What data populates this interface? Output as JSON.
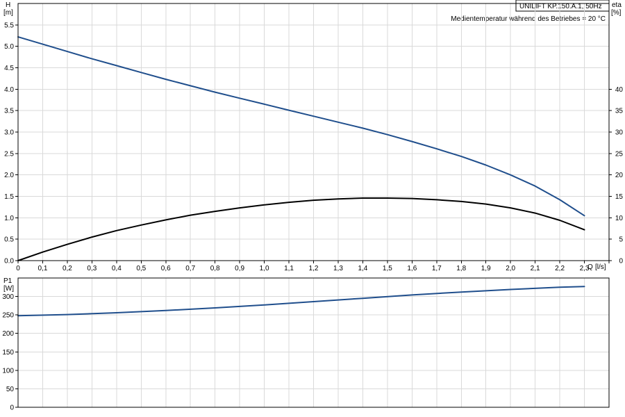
{
  "header": {
    "model": "UNILIFT KP.150.A.1, 50Hz",
    "note": "Medientemperatur während des Betriebes = 20 °C"
  },
  "colors": {
    "head": "#1f4e8c",
    "efficiency": "#000000",
    "power": "#1f4e8c"
  },
  "chart_data": [
    {
      "type": "line",
      "panel": "performance",
      "x_label": "Q",
      "x_unit": "[l/s]",
      "x_ticks": [
        "0",
        "0,1",
        "0,2",
        "0,3",
        "0,4",
        "0,5",
        "0,6",
        "0,7",
        "0,8",
        "0,9",
        "1,0",
        "1,1",
        "1,2",
        "1,3",
        "1,4",
        "1,5",
        "1,6",
        "1,7",
        "1,8",
        "1,9",
        "2,0",
        "2,1",
        "2,2",
        "2,3"
      ],
      "xlim": [
        0,
        2.4
      ],
      "y_label": "H",
      "y_unit": "[m]",
      "y_ticks": [
        "0.0",
        "0.5",
        "1.0",
        "1.5",
        "2.0",
        "2.5",
        "3.0",
        "3.5",
        "4.0",
        "4.5",
        "5.0",
        "5.5"
      ],
      "ylim": [
        0,
        6.0
      ],
      "y2_label": "eta",
      "y2_unit": "[%]",
      "y2_ticks": [
        "0",
        "5",
        "10",
        "15",
        "20",
        "25",
        "30",
        "35",
        "40"
      ],
      "y2lim": [
        0,
        60
      ],
      "grid": true,
      "series": [
        {
          "axis": "left",
          "color": "#1f4e8c",
          "x": [
            0,
            0.1,
            0.2,
            0.3,
            0.4,
            0.5,
            0.6,
            0.7,
            0.8,
            0.9,
            1.0,
            1.1,
            1.2,
            1.3,
            1.4,
            1.5,
            1.6,
            1.7,
            1.8,
            1.9,
            2.0,
            2.1,
            2.2,
            2.3
          ],
          "y": [
            5.22,
            5.05,
            4.88,
            4.71,
            4.55,
            4.39,
            4.23,
            4.08,
            3.93,
            3.79,
            3.65,
            3.51,
            3.37,
            3.23,
            3.09,
            2.94,
            2.78,
            2.61,
            2.43,
            2.23,
            2.0,
            1.74,
            1.42,
            1.05
          ]
        },
        {
          "axis": "right",
          "color": "#000000",
          "x": [
            0,
            0.1,
            0.2,
            0.3,
            0.4,
            0.5,
            0.6,
            0.7,
            0.8,
            0.9,
            1.0,
            1.1,
            1.2,
            1.3,
            1.4,
            1.5,
            1.6,
            1.7,
            1.8,
            1.9,
            2.0,
            2.1,
            2.2,
            2.3
          ],
          "y": [
            0,
            2.0,
            3.8,
            5.5,
            7.0,
            8.3,
            9.5,
            10.6,
            11.5,
            12.3,
            13.0,
            13.6,
            14.1,
            14.4,
            14.6,
            14.6,
            14.5,
            14.2,
            13.8,
            13.2,
            12.3,
            11.1,
            9.4,
            7.2
          ]
        }
      ]
    },
    {
      "type": "line",
      "panel": "power",
      "x_ticks": [],
      "xlim": [
        0,
        2.4
      ],
      "y_label": "P1",
      "y_unit": "[W]",
      "y_ticks": [
        "0",
        "50",
        "100",
        "150",
        "200",
        "250",
        "300"
      ],
      "ylim": [
        0,
        350
      ],
      "grid": true,
      "series": [
        {
          "axis": "left",
          "color": "#1f4e8c",
          "x": [
            0,
            0.2,
            0.4,
            0.6,
            0.8,
            1.0,
            1.2,
            1.4,
            1.6,
            1.8,
            2.0,
            2.2,
            2.3
          ],
          "y": [
            248,
            251,
            256,
            262,
            269,
            277,
            286,
            295,
            304,
            312,
            319,
            325,
            327
          ]
        }
      ]
    }
  ]
}
